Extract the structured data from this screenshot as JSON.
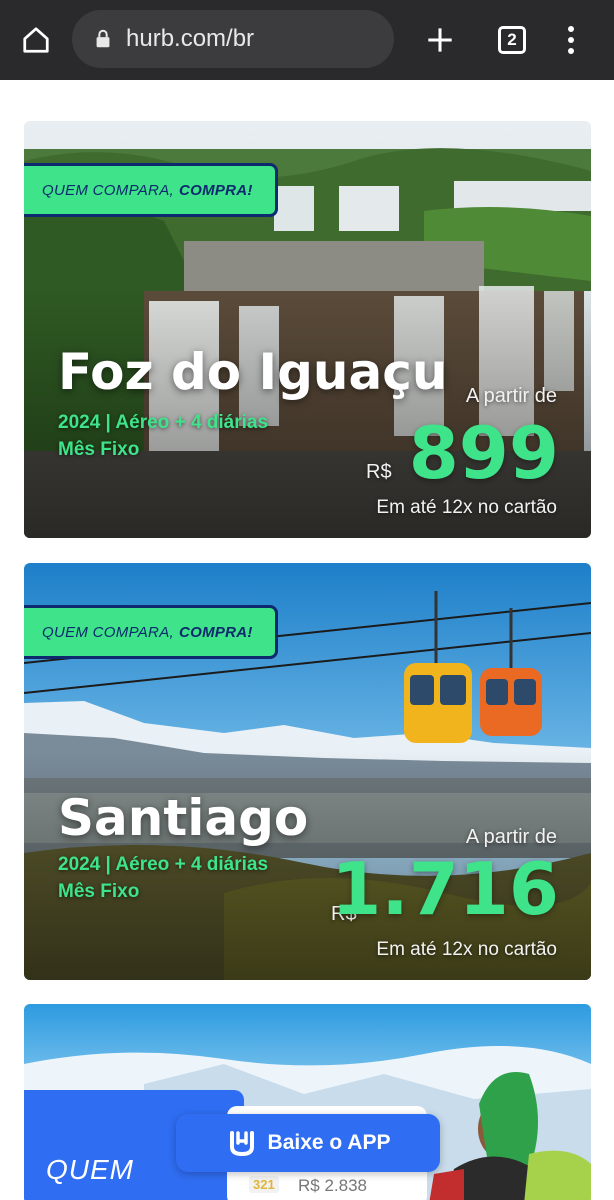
{
  "browser": {
    "url": "hurb.com/br",
    "tab_count": "2",
    "icons": [
      "home-icon",
      "lock-icon",
      "plus-icon",
      "tabs-icon",
      "more-vert-icon"
    ]
  },
  "promo_tag": {
    "prefix": "QUEM COMPARA,",
    "emphasis": "COMPRA!"
  },
  "offers": [
    {
      "destination": "Foz do Iguaçu",
      "subtitle_line1": "2024 | Aéreo + 4 diárias",
      "subtitle_line2": "Mês Fixo",
      "from_label": "A partir de",
      "currency": "R$",
      "price": "899",
      "installments": "Em até 12x no cartão"
    },
    {
      "destination": "Santiago",
      "subtitle_line1": "2024 | Aéreo + 4 diárias",
      "subtitle_line2": "Mês Fixo",
      "from_label": "A partir de",
      "currency": "R$",
      "price": "1.716",
      "installments": "Em até 12x no cartão"
    }
  ],
  "third_card": {
    "headline": "QUEM",
    "mini_badge": "321",
    "mini_price": "R$ 2.838"
  },
  "app_button": {
    "label": "Baixe o APP",
    "icon": "hurb-logo-icon"
  },
  "colors": {
    "brand_green": "#3ee38a",
    "brand_navy": "#0e2a6e",
    "brand_blue": "#2f6df2",
    "browser_bar": "#2a2a2c"
  }
}
